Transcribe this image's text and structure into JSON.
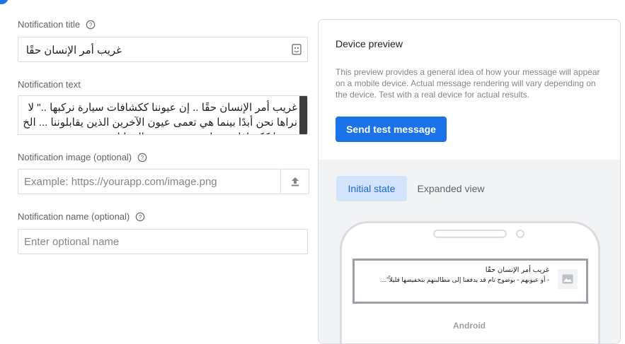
{
  "form": {
    "title_label": "Notification title",
    "title_value": "غريب أمر الإنسان حقًا",
    "text_label": "Notification text",
    "text_value": "غريب أمر الإنسان حقًا .. إن عيوننا ككشافات سيارة نركبها ..\" لا نراها نحن أبدًا بينما هي تعمى عيون الآخرين الذين يقابلوننا ... الخ عيوبنا ككشافات سيارة تعمى عيون المقابلين",
    "image_label": "Notification image (optional)",
    "image_placeholder": "Example: https://yourapp.com/image.png",
    "name_label": "Notification name (optional)",
    "name_placeholder": "Enter optional name"
  },
  "preview": {
    "title": "Device preview",
    "description": "This preview provides a general idea of how your message will appear on a mobile device. Actual message rendering will vary depending on the device. Test with a real device for actual results.",
    "send_button": "Send test message",
    "tabs": [
      "Initial state",
      "Expanded view"
    ],
    "active_tab": "Initial state",
    "notification_title": "غريب أمر الإنسان حقًا",
    "notification_body": "- أو عيوبهم - بوضوح تام قد يدفعنا إلى مطالبتهم بتخفيضها قليلاً\"...",
    "platform": "Android"
  },
  "colors": {
    "accent": "#1a73e8",
    "tab_active_bg": "#d2e3fc",
    "stage_bg": "#f1f3f4"
  },
  "icons": [
    "help-icon",
    "emoji-icon",
    "upload-icon",
    "image-placeholder-icon"
  ]
}
